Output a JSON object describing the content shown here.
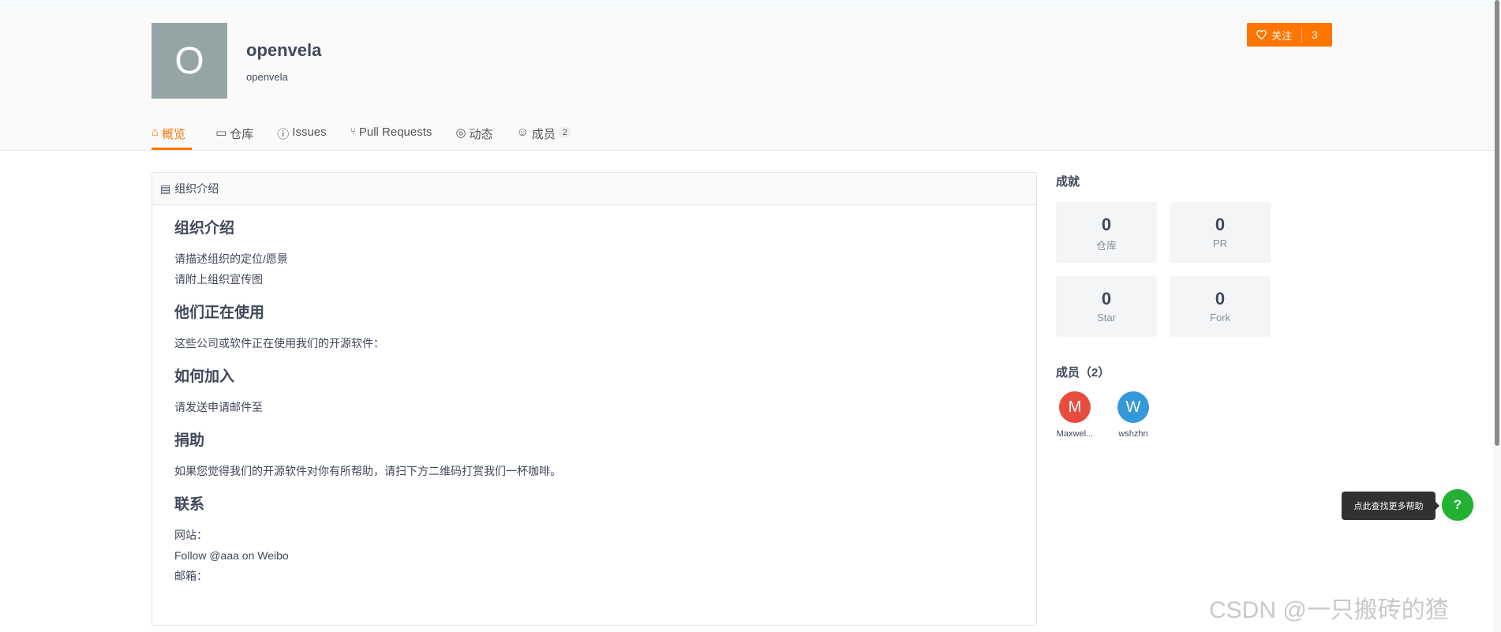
{
  "org": {
    "avatar_letter": "O",
    "name": "openvela",
    "path": "openvela"
  },
  "follow": {
    "label": "关注",
    "count": "3"
  },
  "nav": [
    {
      "label": "概览",
      "icon": "home-icon"
    },
    {
      "label": "仓库",
      "icon": "repo-icon"
    },
    {
      "label": "Issues",
      "icon": "issue-icon"
    },
    {
      "label": "Pull Requests",
      "icon": "pull-request-icon"
    },
    {
      "label": "动态",
      "icon": "activity-icon"
    },
    {
      "label": "成员",
      "icon": "members-icon",
      "badge": "2"
    }
  ],
  "card": {
    "title": "组织介绍",
    "sections": [
      {
        "heading": "组织介绍",
        "lines": [
          "请描述组织的定位/愿景",
          "请附上组织宣传图"
        ]
      },
      {
        "heading": "他们正在使用",
        "lines": [
          "这些公司或软件正在使用我们的开源软件："
        ]
      },
      {
        "heading": "如何加入",
        "lines": [
          "请发送申请邮件至"
        ]
      },
      {
        "heading": "捐助",
        "lines": [
          "如果您觉得我们的开源软件对你有所帮助，请扫下方二维码打赏我们一杯咖啡。"
        ]
      },
      {
        "heading": "联系",
        "lines": [
          "网站：",
          "Follow @aaa on Weibo",
          "邮箱："
        ]
      }
    ]
  },
  "achievements": {
    "title": "成就",
    "stats": [
      {
        "value": "0",
        "label": "仓库"
      },
      {
        "value": "0",
        "label": "PR"
      },
      {
        "value": "0",
        "label": "Star"
      },
      {
        "value": "0",
        "label": "Fork"
      }
    ]
  },
  "members": {
    "title": "成员（2）",
    "list": [
      {
        "letter": "M",
        "name": "Maxwel...",
        "color": "#e74c3c"
      },
      {
        "letter": "W",
        "name": "wshzhn",
        "color": "#3498db"
      }
    ]
  },
  "help": {
    "tooltip": "点此查找更多帮助",
    "icon": "?"
  },
  "watermark": "CSDN @一只搬砖的猹",
  "colors": {
    "accent": "#ff7500",
    "help": "#22b133"
  }
}
